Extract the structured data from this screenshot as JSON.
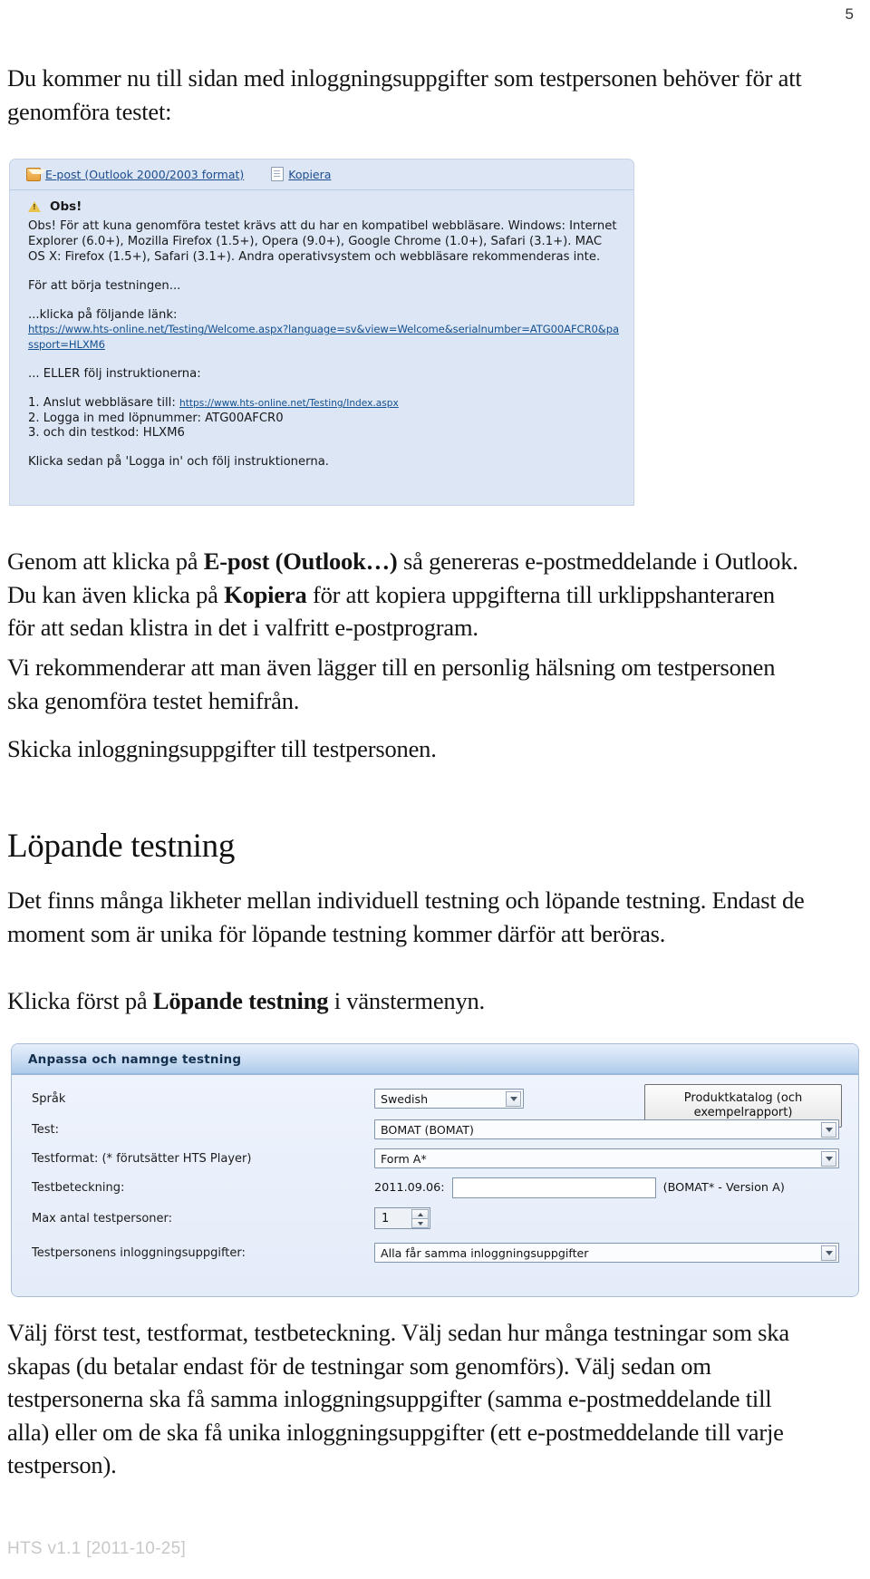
{
  "page": {
    "number": "5",
    "footer": "HTS v1.1 [2011-10-25]"
  },
  "doc": {
    "lead": "Du kommer nu till sidan med inloggningsuppgifter som testpersonen behöver för att genomföra testet:",
    "after_shot1_part1": "Genom att klicka på ",
    "after_shot1_b1": "E-post (Outlook…)",
    "after_shot1_part2": " så genereras e-postmeddelande i Outlook. Du kan även klicka på ",
    "after_shot1_b2": "Kopiera",
    "after_shot1_part3": " för att kopiera uppgifterna till urklippshanteraren för att sedan klistra in det i valfritt e-postprogram.",
    "recommend": "Vi rekommenderar att man även lägger till en personlig hälsning om testpersonen ska genomföra testet hemifrån.",
    "skicka": "Skicka inloggningsuppgifter till testpersonen.",
    "heading_lopande": "Löpande testning",
    "likheter": "Det finns många likheter mellan individuell testning och löpande testning. Endast de moment som är unika för löpande testning kommer därför att beröras.",
    "klicka_forst_part1": "Klicka först på ",
    "klicka_forst_b": "Löpande testning",
    "klicka_forst_part2": " i vänstermenyn.",
    "valj": "Välj först test, testformat, testbeteckning. Välj sedan hur många testningar som ska skapas (du betalar endast för de testningar som genomförs). Välj sedan om testpersonerna ska få samma inloggningsuppgifter (samma e-postmeddelande till alla) eller om de ska få unika inloggningsuppgifter (ett e-postmeddelande till varje testperson)."
  },
  "screenshot_login": {
    "toolbar": {
      "email_label": "E-post (Outlook 2000/2003 format)",
      "copy_label": "Kopiera"
    },
    "notice_title": "Obs!",
    "notice_body": "Obs! För att kuna genomföra testet krävs att du har en kompatibel webbläsare. Windows: Internet Explorer (6.0+), Mozilla Firefox (1.5+), Opera (9.0+), Google Chrome (1.0+), Safari (3.1+). MAC OS X: Firefox (1.5+), Safari (3.1+). Andra operativsystem och webbläsare rekommenderas inte.",
    "start_line": "För att börja testningen...",
    "click_link_line": "...klicka på följande länk:",
    "welcome_url": "https://www.hts-online.net/Testing/Welcome.aspx?language=sv&view=Welcome&serialnumber=ATG00AFCR0&passport=HLXM6",
    "or_line": "... ELLER följ instruktionerna:",
    "step1_prefix": "1. Anslut webbläsare till: ",
    "step1_url": "https://www.hts-online.net/Testing/Index.aspx",
    "step2": "2. Logga in med löpnummer: ATG00AFCR0",
    "step3": "3. och din testkod: HLXM6",
    "final_line": "Klicka sedan på 'Logga in' och följ instruktionerna."
  },
  "screenshot_form": {
    "header_title": "Anpassa och namnge testning",
    "catalog_button": "Produktkatalog (och exempelrapport)",
    "rows": [
      {
        "label": "Språk",
        "value": "Swedish"
      },
      {
        "label": "Test:",
        "value": "BOMAT (BOMAT)"
      },
      {
        "label": "Testformat: (* förutsätter HTS Player)",
        "value": "Form A*"
      },
      {
        "label": "Testbeteckning:",
        "prefix": "2011.09.06:",
        "value": "",
        "suffix": "(BOMAT* - Version A)"
      },
      {
        "label": "Max antal testpersoner:",
        "value": "1"
      },
      {
        "label": "Testpersonens inloggningsuppgifter:",
        "value": "Alla får samma inloggningsuppgifter"
      }
    ]
  },
  "colors": {
    "panel_blue": "#dde6f4",
    "link_blue": "#14508f",
    "header_blue": "#13304f",
    "footer_gray": "#c8c8c8"
  }
}
